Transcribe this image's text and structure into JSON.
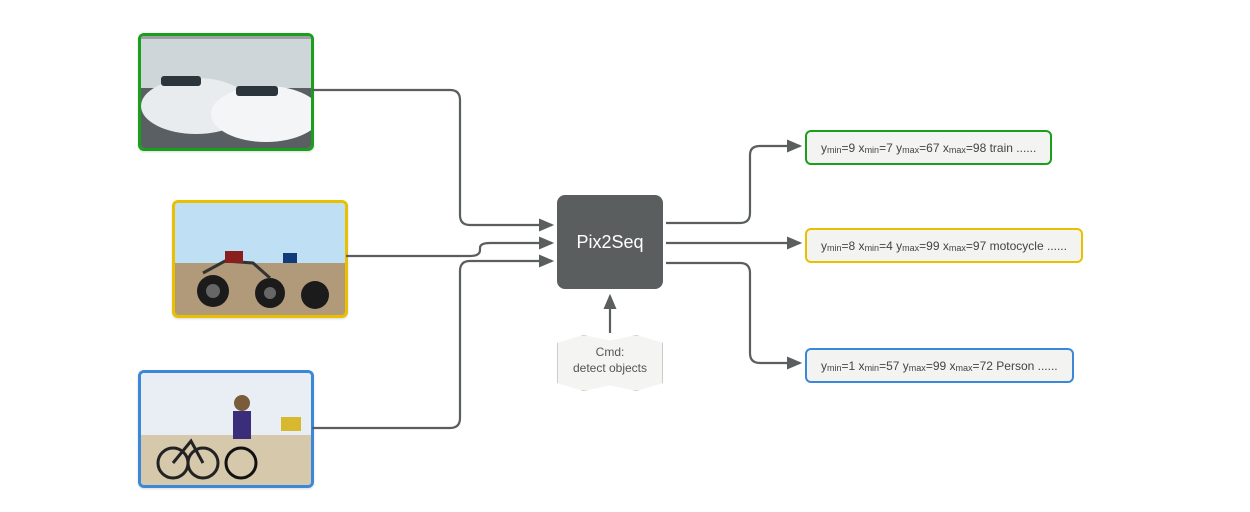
{
  "model_label": "Pix2Seq",
  "cmd_line1": "Cmd:",
  "cmd_line2": "detect objects",
  "images": {
    "train": {
      "border": "green"
    },
    "moto": {
      "border": "yellow"
    },
    "person": {
      "border": "blue"
    }
  },
  "outputs": {
    "train": {
      "ymin": 9,
      "xmin": 7,
      "ymax": 67,
      "xmax": 98,
      "cls": "train",
      "trail": "......"
    },
    "moto": {
      "ymin": 8,
      "xmin": 4,
      "ymax": 99,
      "xmax": 97,
      "cls": "motocycle",
      "trail": "......"
    },
    "person": {
      "ymin": 1,
      "xmin": 57,
      "ymax": 99,
      "xmax": 72,
      "cls": "Person",
      "trail": "......"
    }
  }
}
